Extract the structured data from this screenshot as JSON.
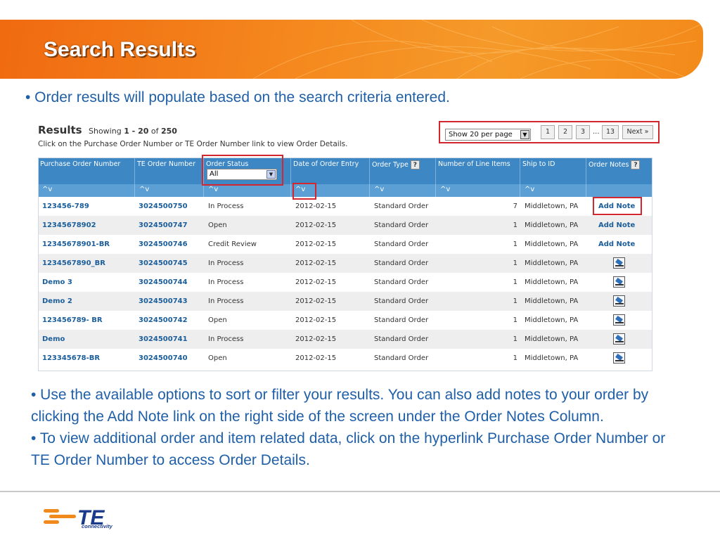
{
  "slide": {
    "title": "Search Results",
    "bullet1": "• Order results will populate based on the search criteria entered.",
    "bullet2": "• Use the available options to sort or filter your results. You can also add notes to your order by clicking the Add Note link on the right side of the screen under the Order Notes Column.",
    "bullet3": "• To view additional order and item related data, click on the hyperlink Purchase Order Number or TE Order Number to access Order Details.",
    "logo_brand": "TE",
    "logo_tagline": "connectivity"
  },
  "results": {
    "heading": "Results",
    "showing_prefix": "Showing",
    "range": "1 - 20",
    "of": "of",
    "total": "250",
    "instructions": "Click on the Purchase Order Number or TE Order Number link to view Order Details."
  },
  "pager": {
    "per_page": "Show 20 per page",
    "pages": [
      "1",
      "2",
      "3"
    ],
    "ellipsis": "...",
    "last_page": "13",
    "next": "Next »"
  },
  "columns": {
    "po": "Purchase Order Number",
    "te": "TE Order Number",
    "status": "Order Status",
    "status_filter": "All",
    "date": "Date of Order Entry",
    "type": "Order Type",
    "lines": "Number of Line Items",
    "ship": "Ship to ID",
    "notes": "Order Notes",
    "help": "?",
    "sort": "^v"
  },
  "rows": [
    {
      "po": "123456-789",
      "te": "3024500750",
      "status": "In Process",
      "date": "2012-02-15",
      "type": "Standard Order",
      "lines": "7",
      "ship": "Middletown, PA",
      "note": "Add Note"
    },
    {
      "po": "12345678902",
      "te": "3024500747",
      "status": "Open",
      "date": "2012-02-15",
      "type": "Standard Order",
      "lines": "1",
      "ship": "Middletown, PA",
      "note": "Add Note"
    },
    {
      "po": "12345678901-BR",
      "te": "3024500746",
      "status": "Credit Review",
      "date": "2012-02-15",
      "type": "Standard Order",
      "lines": "1",
      "ship": "Middletown, PA",
      "note": "Add Note"
    },
    {
      "po": "1234567890_BR",
      "te": "3024500745",
      "status": "In Process",
      "date": "2012-02-15",
      "type": "Standard Order",
      "lines": "1",
      "ship": "Middletown, PA",
      "note": ""
    },
    {
      "po": "Demo 3",
      "te": "3024500744",
      "status": "In Process",
      "date": "2012-02-15",
      "type": "Standard Order",
      "lines": "1",
      "ship": "Middletown, PA",
      "note": ""
    },
    {
      "po": "Demo 2",
      "te": "3024500743",
      "status": "In Process",
      "date": "2012-02-15",
      "type": "Standard Order",
      "lines": "1",
      "ship": "Middletown, PA",
      "note": ""
    },
    {
      "po": "123456789- BR",
      "te": "3024500742",
      "status": "Open",
      "date": "2012-02-15",
      "type": "Standard Order",
      "lines": "1",
      "ship": "Middletown, PA",
      "note": ""
    },
    {
      "po": "Demo",
      "te": "3024500741",
      "status": "In Process",
      "date": "2012-02-15",
      "type": "Standard Order",
      "lines": "1",
      "ship": "Middletown, PA",
      "note": ""
    },
    {
      "po": "123345678-BR",
      "te": "3024500740",
      "status": "Open",
      "date": "2012-02-15",
      "type": "Standard Order",
      "lines": "1",
      "ship": "Middletown, PA",
      "note": ""
    }
  ],
  "colors": {
    "banner": "#f58a1f",
    "header": "#3d87c4",
    "sortbar": "#5b9fd4",
    "link": "#1b5e9b",
    "highlight": "#d4262e",
    "bullet_text": "#1f5fa8"
  }
}
